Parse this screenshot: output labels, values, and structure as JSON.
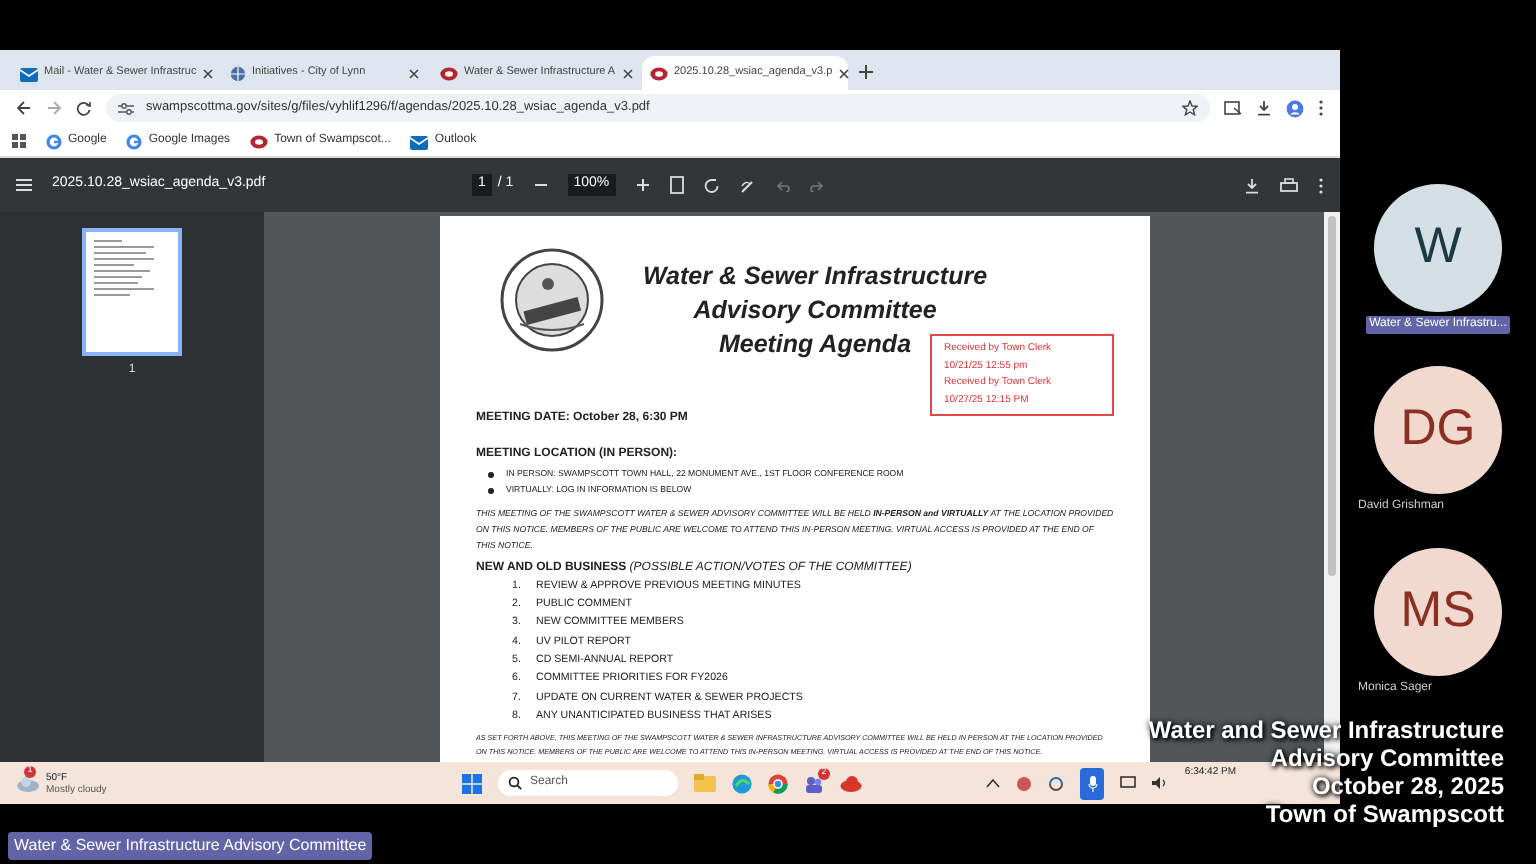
{
  "browser": {
    "tabs": [
      {
        "title": "Mail - Water & Sewer Infrastruc",
        "kind": "mail",
        "selected": false
      },
      {
        "title": "Initiatives - City of Lynn",
        "kind": "globe",
        "selected": false
      },
      {
        "title": "Water & Sewer Infrastructure A",
        "kind": "town",
        "selected": false
      },
      {
        "title": "2025.10.28_wsiac_agenda_v3.p",
        "kind": "town",
        "selected": true
      }
    ],
    "url": "swampscottma.gov/sites/g/files/vyhlif1296/f/agendas/2025.10.28_wsiac_agenda_v3.pdf",
    "bookmarks": [
      {
        "label": "Google",
        "kind": "google"
      },
      {
        "label": "Google Images",
        "kind": "google"
      },
      {
        "label": "Town of Swampscot...",
        "kind": "town"
      },
      {
        "label": "Outlook",
        "kind": "mail"
      }
    ]
  },
  "pdf_viewer": {
    "filename": "2025.10.28_wsiac_agenda_v3.pdf",
    "page": "1",
    "page_total": "/ 1",
    "zoom": "100%",
    "thumbnail_label": "1"
  },
  "document": {
    "title_lines": [
      "Water & Sewer Infrastructure",
      "Advisory Committee",
      "Meeting Agenda"
    ],
    "stamp_lines": [
      "Received by Town Clerk",
      "10/21/25 12:55 pm",
      "Received by Town Clerk",
      "10/27/25 12:15 PM"
    ],
    "meeting_date": "MEETING DATE: October 28, 6:30 PM",
    "location_heading": "MEETING LOCATION (IN PERSON):",
    "location_items": [
      "IN PERSON: SWAMPSCOTT TOWN HALL, 22 MONUMENT AVE., 1ST FLOOR CONFERENCE ROOM",
      "VIRTUALLY: LOG IN INFORMATION IS BELOW"
    ],
    "notice": "THIS MEETING OF THE SWAMPSCOTT WATER & SEWER ADVISORY COMMITTEE WILL BE HELD **IN-PERSON and VIRTUALLY** AT THE LOCATION PROVIDED ON THIS NOTICE. MEMBERS OF THE PUBLIC ARE WELCOME TO ATTEND THIS IN-PERSON MEETING. VIRTUAL ACCESS IS PROVIDED AT THE END OF THIS NOTICE.",
    "business_heading": "**NEW AND OLD BUSINESS** *(POSSIBLE ACTION/VOTES OF THE COMMITTEE)*",
    "business_items": [
      {
        "number": "1.",
        "text": "REVIEW & APPROVE PREVIOUS MEETING MINUTES"
      },
      {
        "number": "2.",
        "text": "PUBLIC COMMENT"
      },
      {
        "number": "3.",
        "text": "NEW COMMITTEE MEMBERS"
      },
      {
        "number": "4.",
        "text": "UV PILOT REPORT"
      },
      {
        "number": "5.",
        "text": "CD SEMI-ANNUAL REPORT"
      },
      {
        "number": "6.",
        "text": "COMMITTEE PRIORITIES FOR FY2026"
      },
      {
        "number": "7.",
        "text": "UPDATE ON CURRENT WATER & SEWER PROJECTS"
      },
      {
        "number": "8.",
        "text": "ANY UNANTICIPATED BUSINESS THAT ARISES"
      }
    ],
    "closing": "AS SET FORTH ABOVE, THIS MEETING OF THE SWAMPSCOTT WATER & SEWER INFRASTRUCTURE ADVISORY COMMITTEE WILL BE HELD IN PERSON AT THE LOCATION PROVIDED ON THIS NOTICE. MEMBERS OF THE PUBLIC ARE WELCOME TO ATTEND THIS IN-PERSON MEETING. VIRTUAL ACCESS IS PROVIDED AT THE END OF THIS NOTICE."
  },
  "taskbar": {
    "weather_badge": "1",
    "temperature": "50°F",
    "condition": "Mostly cloudy",
    "search_placeholder": "Search",
    "teams_badge": "2",
    "clock": "6:34:42 PM"
  },
  "participants": [
    {
      "initials": "W",
      "name": "Water & Sewer Infrastru...",
      "color": "#d3dfe4",
      "highlighted": true
    },
    {
      "initials": "DG",
      "name": "David Grishman",
      "color": "#f2d9cf",
      "highlighted": false
    },
    {
      "initials": "MS",
      "name": "Monica Sager",
      "color": "#f2d9cf",
      "highlighted": false
    }
  ],
  "caption_lines": [
    "Water and Sewer Infrastructure",
    "Advisory Committee",
    "October 28, 2025",
    "Town of Swampscott"
  ],
  "meeting_label": "Water & Sewer Infrastructure Advisory Committee"
}
